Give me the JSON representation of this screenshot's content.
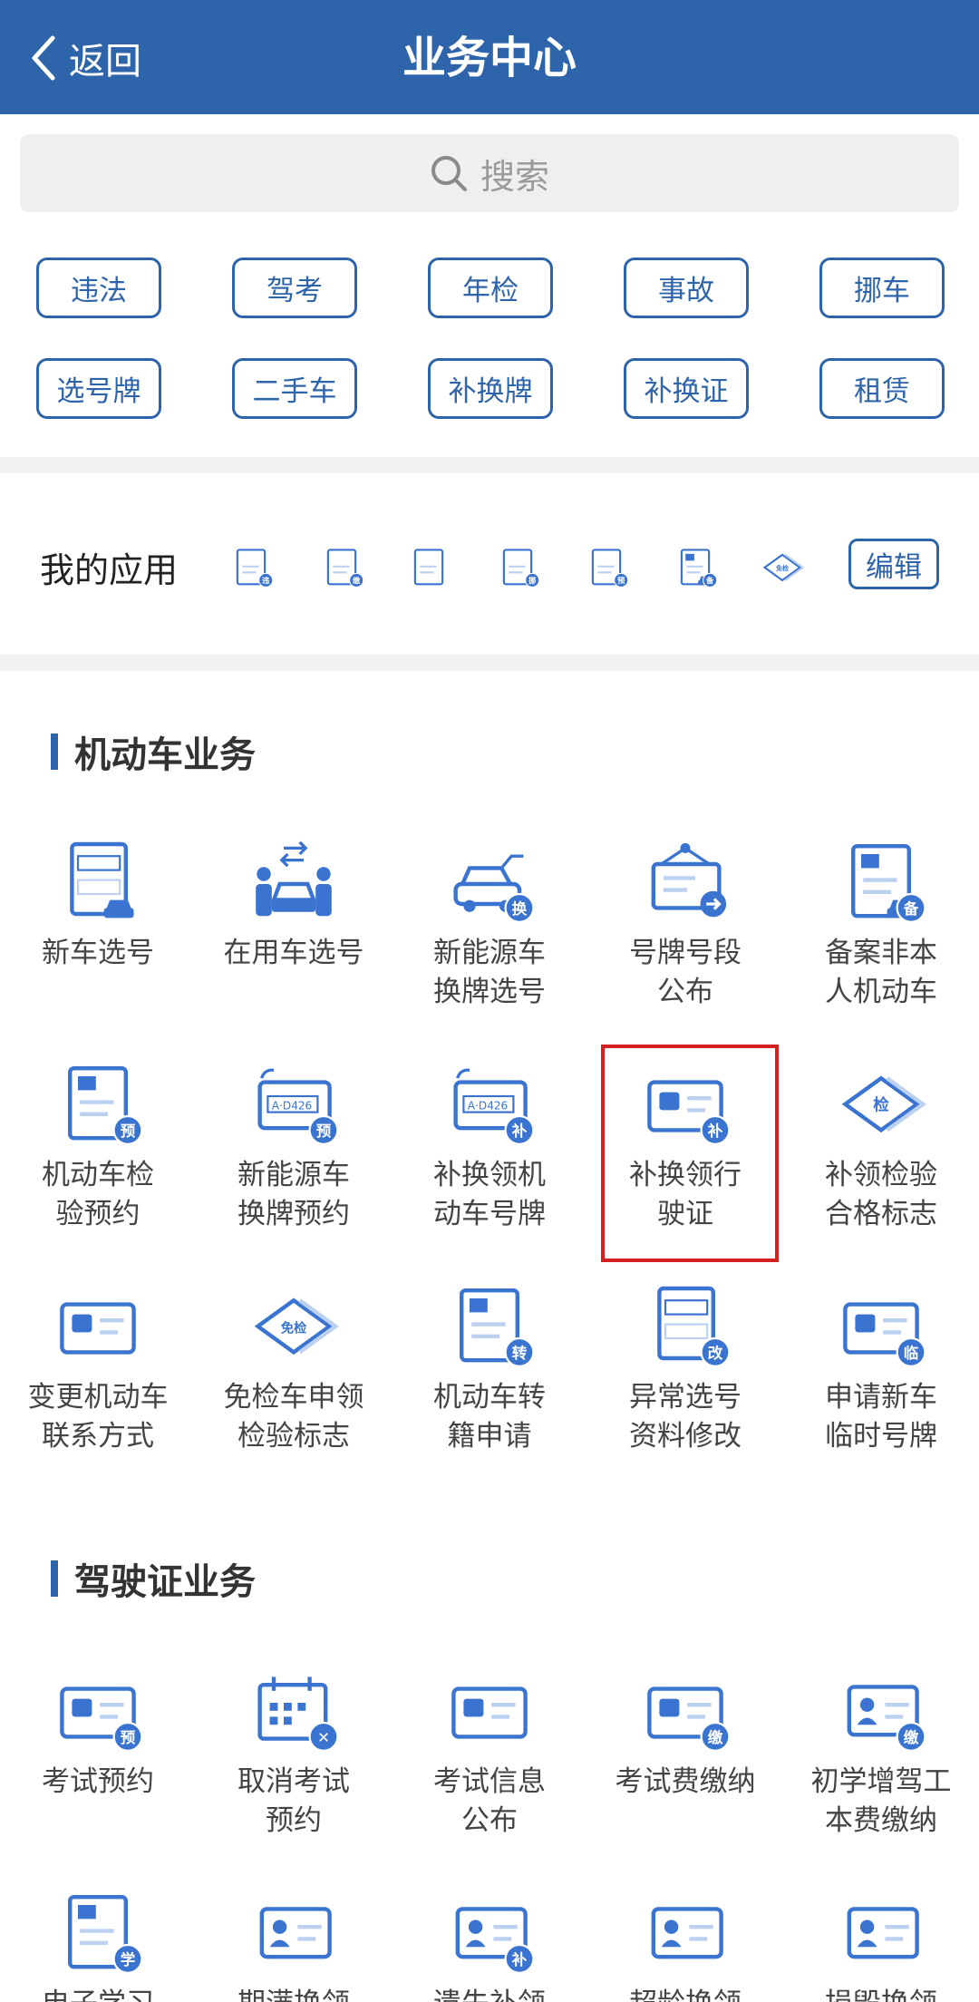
{
  "header": {
    "back_label": "返回",
    "title": "业务中心"
  },
  "search": {
    "placeholder": "搜索"
  },
  "quick_tags": [
    "违法",
    "驾考",
    "年检",
    "事故",
    "挪车",
    "选号牌",
    "二手车",
    "补换牌",
    "补换证",
    "租赁"
  ],
  "my_apps": {
    "label": "我的应用",
    "edit_label": "编辑",
    "icons": [
      "car-violation-icon",
      "fee-document-icon",
      "plate-change-icon",
      "move-car-icon",
      "inspection-booking-icon",
      "record-car-icon",
      "exemption-badge-icon"
    ],
    "icon_badges": [
      "违",
      "缴",
      "",
      "挪",
      "预",
      "备",
      "免检"
    ]
  },
  "sections": {
    "vehicle": {
      "title": "机动车业务"
    },
    "license": {
      "title": "驾驶证业务"
    }
  },
  "vehicle_items": [
    {
      "label": "新车选号",
      "icon": "plate-select-icon",
      "badge": ""
    },
    {
      "label": "在用车选号",
      "icon": "car-exchange-icon",
      "badge": ""
    },
    {
      "label": "新能源车\n换牌选号",
      "icon": "ev-car-icon",
      "badge": "换"
    },
    {
      "label": "号牌号段\n公布",
      "icon": "plate-board-icon",
      "badge": ""
    },
    {
      "label": "备案非本\n人机动车",
      "icon": "record-car-icon",
      "badge": "备"
    },
    {
      "label": "机动车检\n验预约",
      "icon": "inspection-doc-icon",
      "badge": "预"
    },
    {
      "label": "新能源车\n换牌预约",
      "icon": "ev-plate-icon",
      "badge": "预"
    },
    {
      "label": "补换领机\n动车号牌",
      "icon": "plate-replace-icon",
      "badge": "补"
    },
    {
      "label": "补换领行\n驶证",
      "icon": "driving-permit-icon",
      "badge": "补"
    },
    {
      "label": "补领检验\n合格标志",
      "icon": "inspection-badge-icon",
      "badge": "检"
    },
    {
      "label": "变更机动车\n联系方式",
      "icon": "contact-change-icon",
      "badge": ""
    },
    {
      "label": "免检车申领\n检验标志",
      "icon": "exemption-badge-icon",
      "badge": "免检"
    },
    {
      "label": "机动车转\n籍申请",
      "icon": "transfer-doc-icon",
      "badge": "转"
    },
    {
      "label": "异常选号\n资料修改",
      "icon": "plate-edit-icon",
      "badge": "改"
    },
    {
      "label": "申请新车\n临时号牌",
      "icon": "temp-plate-icon",
      "badge": "临"
    }
  ],
  "license_items": [
    {
      "label": "考试预约",
      "icon": "exam-booking-icon",
      "badge": "预"
    },
    {
      "label": "取消考试\n预约",
      "icon": "cancel-exam-icon",
      "badge": "✕"
    },
    {
      "label": "考试信息\n公布",
      "icon": "exam-notice-icon",
      "badge": ""
    },
    {
      "label": "考试费缴纳",
      "icon": "exam-fee-icon",
      "badge": "缴"
    },
    {
      "label": "初学增驾工\n本费缴纳",
      "icon": "learner-fee-icon",
      "badge": "缴"
    },
    {
      "label": "电子学习",
      "icon": "study-doc-icon",
      "badge": "学"
    },
    {
      "label": "期满换领",
      "icon": "expiry-renew-icon",
      "badge": ""
    },
    {
      "label": "遗失补领",
      "icon": "lost-replace-icon",
      "badge": "补"
    },
    {
      "label": "超龄换领",
      "icon": "overage-renew-icon",
      "badge": ""
    },
    {
      "label": "损毁换领",
      "icon": "damaged-renew-icon",
      "badge": ""
    }
  ],
  "colors": {
    "primary": "#2e64aa",
    "icon_blue": "#3a74d0",
    "highlight": "#d61f1f"
  }
}
